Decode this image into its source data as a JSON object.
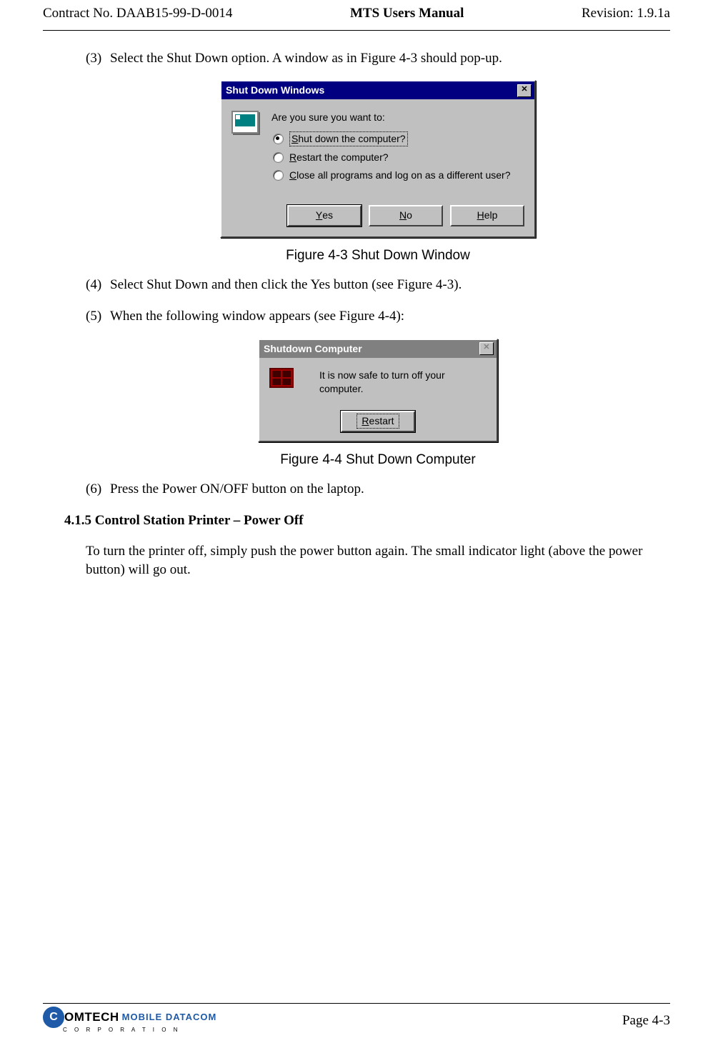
{
  "header": {
    "left": "Contract No. DAAB15-99-D-0014",
    "center": "MTS Users Manual",
    "right": "Revision:  1.9.1a"
  },
  "steps": {
    "s3_num": "(3)",
    "s3_text": "Select the Shut Down option.  A window as in Figure 4-3 should pop-up.",
    "s4_num": "(4)",
    "s4_text": "Select Shut Down and then click the Yes button (see Figure 4-3).",
    "s5_num": "(5)",
    "s5_text": "When the following window appears (see Figure 4-4):",
    "s6_num": "(6)",
    "s6_text": "Press the Power ON/OFF button on the laptop."
  },
  "fig1": {
    "title": "Shut Down Windows",
    "prompt": "Are you sure you want to:",
    "opt1_pre": "S",
    "opt1_rest": "hut down the computer?",
    "opt2_pre": "R",
    "opt2_rest": "estart the computer?",
    "opt3_pre": "C",
    "opt3_rest": "lose all programs and log on as a different user?",
    "btn_yes_u": "Y",
    "btn_yes_r": "es",
    "btn_no_u": "N",
    "btn_no_r": "o",
    "btn_help_u": "H",
    "btn_help_r": "elp",
    "caption": "Figure 4-3     Shut Down Window"
  },
  "fig2": {
    "title": "Shutdown Computer",
    "msg": "It is now safe to turn off your computer.",
    "btn_u": "R",
    "btn_r": "estart",
    "caption": "Figure 4-4     Shut Down Computer"
  },
  "section": {
    "heading": "4.1.5  Control Station Printer – Power Off",
    "para": "To turn the printer off, simply push the power button again.  The small indicator light (above the power button) will go out."
  },
  "footer": {
    "logo_inner": "C",
    "logo_text1": "OMTECH",
    "logo_text2": "MOBILE DATACOM",
    "logo_sub": "C O R P O R A T I O N",
    "page": "Page 4-3"
  }
}
